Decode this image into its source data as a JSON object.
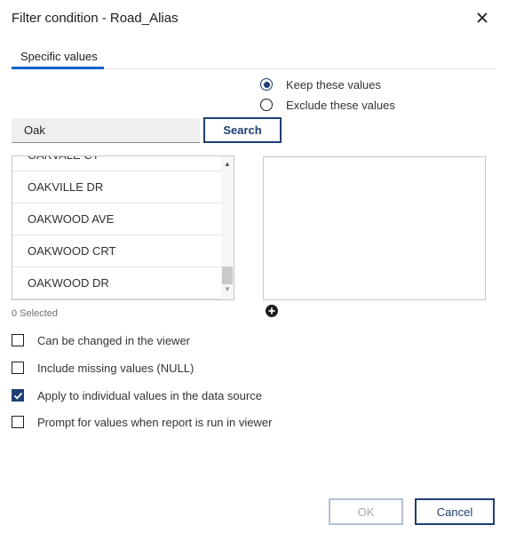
{
  "dialog": {
    "title": "Filter condition - Road_Alias"
  },
  "tabs": [
    {
      "label": "Specific values",
      "active": true
    }
  ],
  "mode": {
    "options": [
      {
        "label": "Keep these values",
        "checked": true
      },
      {
        "label": "Exclude these values",
        "checked": false
      }
    ]
  },
  "search": {
    "value": "Oak",
    "button_label": "Search"
  },
  "values_list": {
    "items": [
      "OAKVALE CT",
      "OAKVILLE DR",
      "OAKWOOD AVE",
      "OAKWOOD CRT",
      "OAKWOOD DR"
    ]
  },
  "selection": {
    "count_text": "0 Selected"
  },
  "options": [
    {
      "label": "Can be changed in the viewer",
      "checked": false
    },
    {
      "label": "Include missing values (NULL)",
      "checked": false
    },
    {
      "label": "Apply to individual values in the data source",
      "checked": true
    },
    {
      "label": "Prompt for values when report is run in viewer",
      "checked": false
    }
  ],
  "footer": {
    "ok_label": "OK",
    "cancel_label": "Cancel"
  },
  "colors": {
    "accent": "#1f3e74",
    "tab_underline": "#0f62c8"
  }
}
